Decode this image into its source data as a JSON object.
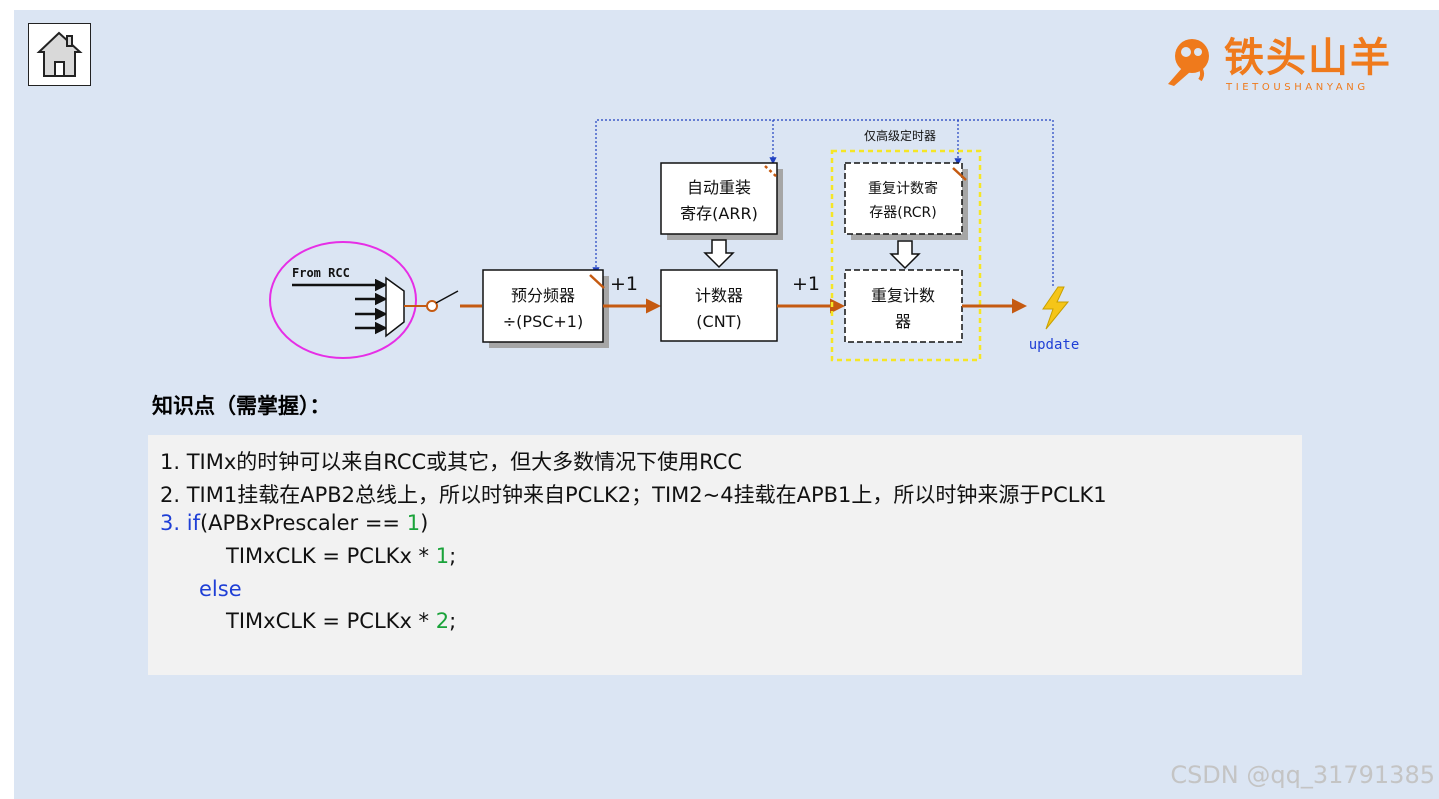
{
  "header": {
    "home_icon": "home-icon",
    "logo_name": "铁头山羊",
    "logo_sub": "TIETOUSHANYANG"
  },
  "diagram": {
    "source_label": "From RCC",
    "prescaler_line1": "预分频器",
    "prescaler_line2": "÷(PSC+1)",
    "plus_one_a": "+1",
    "arr_line1": "自动重装",
    "arr_line2": "寄存(ARR)",
    "cnt_line1": "计数器",
    "cnt_line2": "(CNT)",
    "plus_one_b": "+1",
    "advanced_only": "仅高级定时器",
    "rcr_line1": "重复计数寄",
    "rcr_line2": "存器(RCR)",
    "rep_line1": "重复计数",
    "rep_line2": "器",
    "update_label": "update",
    "update_icon": "lightning-icon",
    "colors": {
      "arrow": "#c55a11",
      "dotted": "#2040c0",
      "ellipse": "#e62ee6",
      "highlight": "#f5e625"
    }
  },
  "knowledge": {
    "title": "知识点（需掌握）：",
    "line1": "1. TIMx的时钟可以来自RCC或其它，但大多数情况下使用RCC",
    "line2": "2. TIM1挂载在APB2总线上，所以时钟来自PCLK2；TIM2~4挂载在APB1上，所以时钟来源于PCLK1",
    "line3_num": "3.",
    "line3_kw": "if",
    "line3_a": "(APBxPrescaler == ",
    "line3_n": "1",
    "line3_b": ")",
    "line4_a": "TIMxCLK = PCLKx * ",
    "line4_n": "1",
    "line4_b": ";",
    "line5_kw": "else",
    "line6_a": "TIMxCLK = PCLKx * ",
    "line6_n": "2",
    "line6_b": ";"
  },
  "watermark": "CSDN @qq_31791385"
}
